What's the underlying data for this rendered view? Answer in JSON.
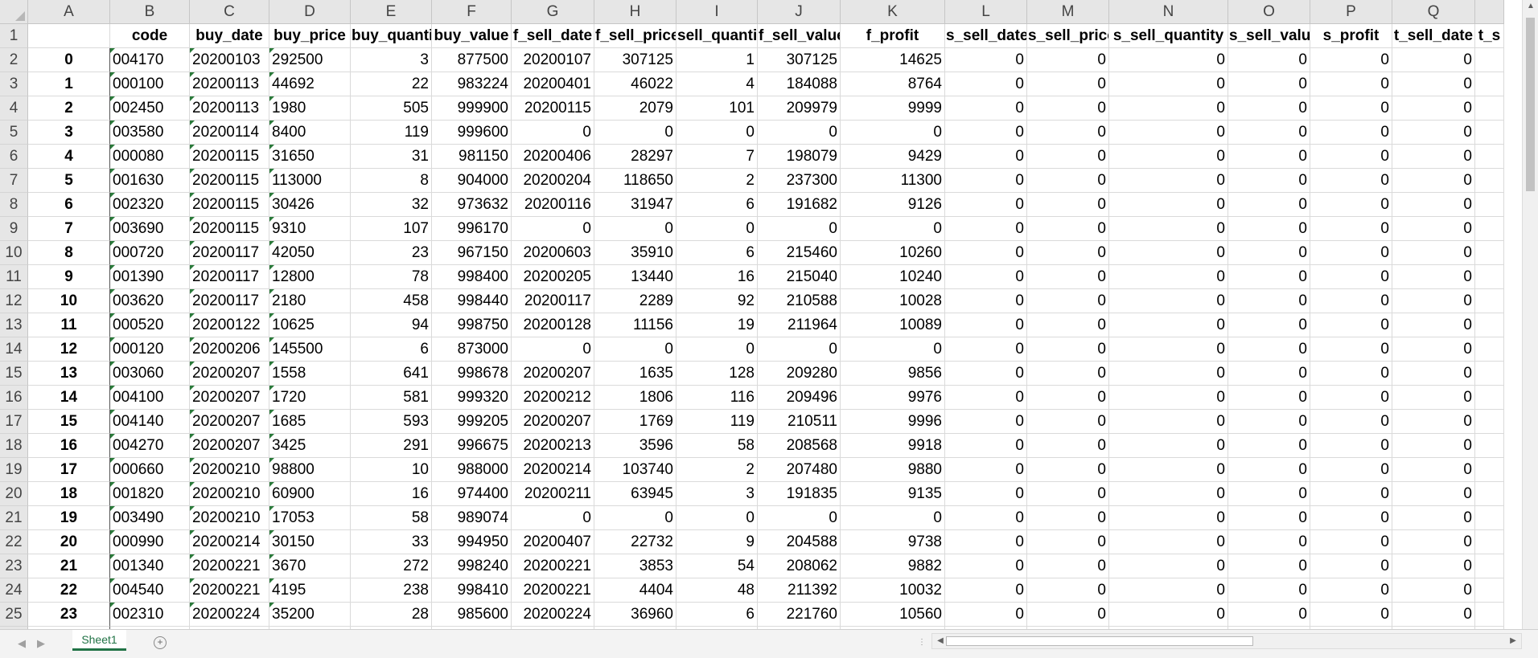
{
  "columns": [
    "A",
    "B",
    "C",
    "D",
    "E",
    "F",
    "G",
    "H",
    "I",
    "J",
    "K",
    "L",
    "M",
    "N",
    "O",
    "P",
    "Q"
  ],
  "headers": [
    "",
    "code",
    "buy_date",
    "buy_price",
    "buy_quantity",
    "buy_value",
    "f_sell_date",
    "f_sell_price",
    "sell_quantit",
    "f_sell_value",
    "f_profit",
    "s_sell_date",
    "s_sell_price",
    "s_sell_quantity",
    "s_sell_value",
    "s_profit",
    "t_sell_date",
    "t_s"
  ],
  "rows": [
    [
      "0",
      "004170",
      "20200103",
      "292500",
      "3",
      "877500",
      "20200107",
      "307125",
      "1",
      "307125",
      "14625",
      "0",
      "0",
      "0",
      "0",
      "0",
      "0"
    ],
    [
      "1",
      "000100",
      "20200113",
      "44692",
      "22",
      "983224",
      "20200401",
      "46022",
      "4",
      "184088",
      "8764",
      "0",
      "0",
      "0",
      "0",
      "0",
      "0"
    ],
    [
      "2",
      "002450",
      "20200113",
      "1980",
      "505",
      "999900",
      "20200115",
      "2079",
      "101",
      "209979",
      "9999",
      "0",
      "0",
      "0",
      "0",
      "0",
      "0"
    ],
    [
      "3",
      "003580",
      "20200114",
      "8400",
      "119",
      "999600",
      "0",
      "0",
      "0",
      "0",
      "0",
      "0",
      "0",
      "0",
      "0",
      "0",
      "0"
    ],
    [
      "4",
      "000080",
      "20200115",
      "31650",
      "31",
      "981150",
      "20200406",
      "28297",
      "7",
      "198079",
      "9429",
      "0",
      "0",
      "0",
      "0",
      "0",
      "0"
    ],
    [
      "5",
      "001630",
      "20200115",
      "113000",
      "8",
      "904000",
      "20200204",
      "118650",
      "2",
      "237300",
      "11300",
      "0",
      "0",
      "0",
      "0",
      "0",
      "0"
    ],
    [
      "6",
      "002320",
      "20200115",
      "30426",
      "32",
      "973632",
      "20200116",
      "31947",
      "6",
      "191682",
      "9126",
      "0",
      "0",
      "0",
      "0",
      "0",
      "0"
    ],
    [
      "7",
      "003690",
      "20200115",
      "9310",
      "107",
      "996170",
      "0",
      "0",
      "0",
      "0",
      "0",
      "0",
      "0",
      "0",
      "0",
      "0",
      "0"
    ],
    [
      "8",
      "000720",
      "20200117",
      "42050",
      "23",
      "967150",
      "20200603",
      "35910",
      "6",
      "215460",
      "10260",
      "0",
      "0",
      "0",
      "0",
      "0",
      "0"
    ],
    [
      "9",
      "001390",
      "20200117",
      "12800",
      "78",
      "998400",
      "20200205",
      "13440",
      "16",
      "215040",
      "10240",
      "0",
      "0",
      "0",
      "0",
      "0",
      "0"
    ],
    [
      "10",
      "003620",
      "20200117",
      "2180",
      "458",
      "998440",
      "20200117",
      "2289",
      "92",
      "210588",
      "10028",
      "0",
      "0",
      "0",
      "0",
      "0",
      "0"
    ],
    [
      "11",
      "000520",
      "20200122",
      "10625",
      "94",
      "998750",
      "20200128",
      "11156",
      "19",
      "211964",
      "10089",
      "0",
      "0",
      "0",
      "0",
      "0",
      "0"
    ],
    [
      "12",
      "000120",
      "20200206",
      "145500",
      "6",
      "873000",
      "0",
      "0",
      "0",
      "0",
      "0",
      "0",
      "0",
      "0",
      "0",
      "0",
      "0"
    ],
    [
      "13",
      "003060",
      "20200207",
      "1558",
      "641",
      "998678",
      "20200207",
      "1635",
      "128",
      "209280",
      "9856",
      "0",
      "0",
      "0",
      "0",
      "0",
      "0"
    ],
    [
      "14",
      "004100",
      "20200207",
      "1720",
      "581",
      "999320",
      "20200212",
      "1806",
      "116",
      "209496",
      "9976",
      "0",
      "0",
      "0",
      "0",
      "0",
      "0"
    ],
    [
      "15",
      "004140",
      "20200207",
      "1685",
      "593",
      "999205",
      "20200207",
      "1769",
      "119",
      "210511",
      "9996",
      "0",
      "0",
      "0",
      "0",
      "0",
      "0"
    ],
    [
      "16",
      "004270",
      "20200207",
      "3425",
      "291",
      "996675",
      "20200213",
      "3596",
      "58",
      "208568",
      "9918",
      "0",
      "0",
      "0",
      "0",
      "0",
      "0"
    ],
    [
      "17",
      "000660",
      "20200210",
      "98800",
      "10",
      "988000",
      "20200214",
      "103740",
      "2",
      "207480",
      "9880",
      "0",
      "0",
      "0",
      "0",
      "0",
      "0"
    ],
    [
      "18",
      "001820",
      "20200210",
      "60900",
      "16",
      "974400",
      "20200211",
      "63945",
      "3",
      "191835",
      "9135",
      "0",
      "0",
      "0",
      "0",
      "0",
      "0"
    ],
    [
      "19",
      "003490",
      "20200210",
      "17053",
      "58",
      "989074",
      "0",
      "0",
      "0",
      "0",
      "0",
      "0",
      "0",
      "0",
      "0",
      "0",
      "0"
    ],
    [
      "20",
      "000990",
      "20200214",
      "30150",
      "33",
      "994950",
      "20200407",
      "22732",
      "9",
      "204588",
      "9738",
      "0",
      "0",
      "0",
      "0",
      "0",
      "0"
    ],
    [
      "21",
      "001340",
      "20200221",
      "3670",
      "272",
      "998240",
      "20200221",
      "3853",
      "54",
      "208062",
      "9882",
      "0",
      "0",
      "0",
      "0",
      "0",
      "0"
    ],
    [
      "22",
      "004540",
      "20200221",
      "4195",
      "238",
      "998410",
      "20200221",
      "4404",
      "48",
      "211392",
      "10032",
      "0",
      "0",
      "0",
      "0",
      "0",
      "0"
    ],
    [
      "23",
      "002310",
      "20200224",
      "35200",
      "28",
      "985600",
      "20200224",
      "36960",
      "6",
      "221760",
      "10560",
      "0",
      "0",
      "0",
      "0",
      "0",
      "0"
    ]
  ],
  "sheet_tab": "Sheet1",
  "icons": {
    "nav_prev": "◀",
    "nav_next": "▶",
    "add_sheet": "+",
    "split": "⋮",
    "scroll_up": "▲",
    "scroll_down": "▼",
    "scroll_left": "◀",
    "scroll_right": "▶"
  }
}
